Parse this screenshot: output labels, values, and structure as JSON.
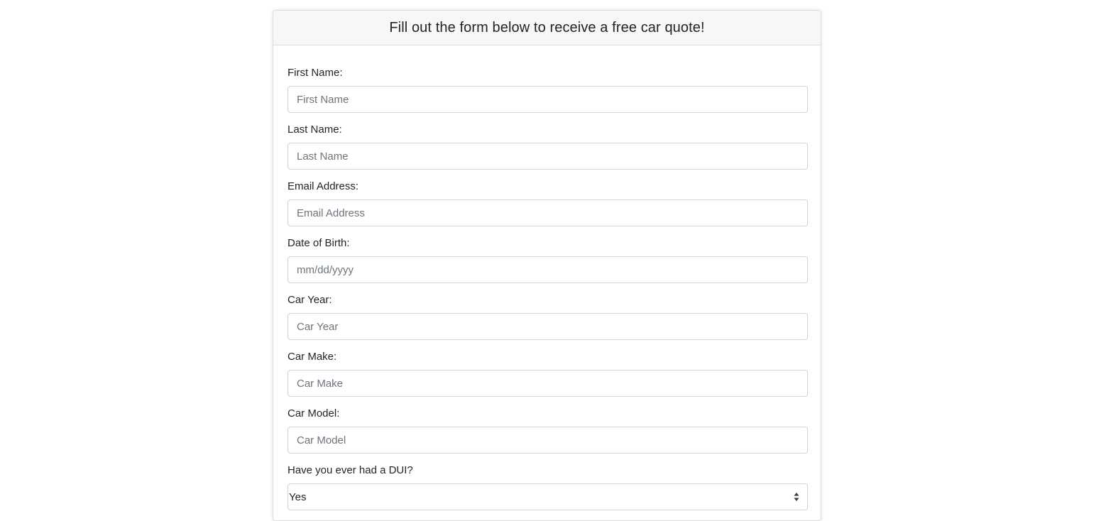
{
  "form": {
    "title": "Fill out the form below to receive a free car quote!",
    "fields": {
      "first_name": {
        "label": "First Name:",
        "placeholder": "First Name"
      },
      "last_name": {
        "label": "Last Name:",
        "placeholder": "Last Name"
      },
      "email": {
        "label": "Email Address:",
        "placeholder": "Email Address"
      },
      "dob": {
        "label": "Date of Birth:",
        "placeholder": "mm/dd/yyyy"
      },
      "car_year": {
        "label": "Car Year:",
        "placeholder": "Car Year"
      },
      "car_make": {
        "label": "Car Make:",
        "placeholder": "Car Make"
      },
      "car_model": {
        "label": "Car Model:",
        "placeholder": "Car Model"
      },
      "dui": {
        "label": "Have you ever had a DUI?",
        "selected": "Yes"
      }
    }
  },
  "icons": {
    "select_arrow": "select-updown-icon"
  },
  "colors": {
    "header_bg": "#f7f7f7",
    "border": "#ced4da",
    "text": "#212529",
    "placeholder": "#6c757d"
  }
}
